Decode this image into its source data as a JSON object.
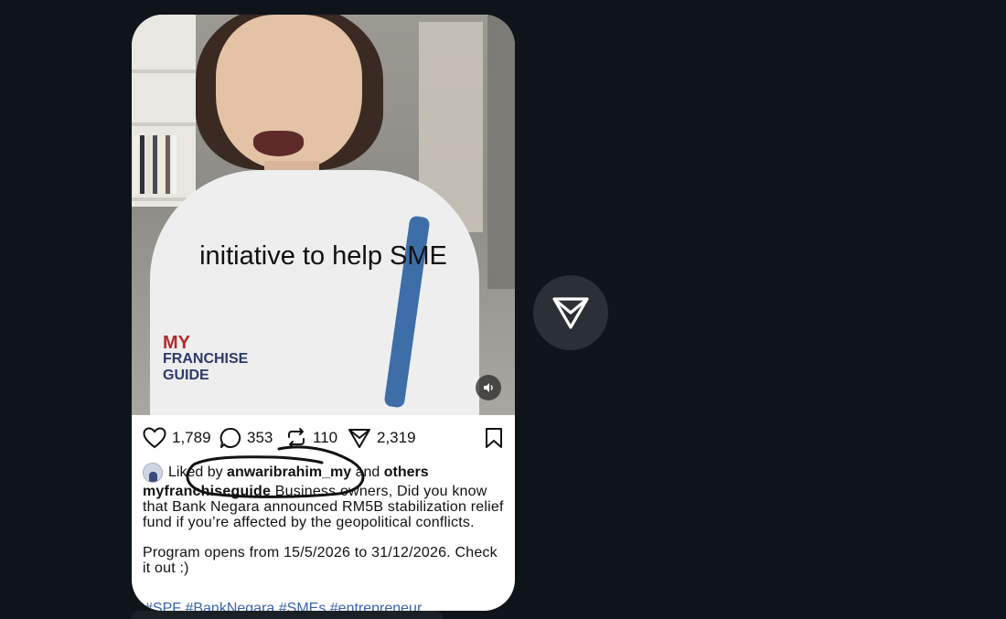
{
  "post": {
    "media": {
      "caption_overlay": "initiative to help SME",
      "shirt_logo": {
        "line1": "MY",
        "line2": "FRANCHISE",
        "line3": "GUIDE"
      }
    },
    "stats": {
      "likes": "1,789",
      "comments": "353",
      "reposts": "110",
      "shares": "2,319"
    },
    "liked_by": {
      "prefix": "Liked by",
      "user": "anwaribrahim_my",
      "connector": "and",
      "others": "others"
    },
    "caption": {
      "username": "myfranchiseguide",
      "text": "Business owners, Did you know that Bank Negara announced RM5B stabilization relief fund if you’re affected by the geopolitical conflicts.",
      "paragraph2": "Program opens from 15/5/2026 to 31/12/2026. Check it out :)",
      "hashtags": "#SPF #BankNegara #SMEs #entrepreneur"
    }
  },
  "icons": {
    "like": "heart-icon",
    "comment": "comment-icon",
    "repost": "repost-icon",
    "share": "share-icon",
    "bookmark": "bookmark-icon",
    "mute": "speaker-icon",
    "fab": "share-triangle-icon"
  },
  "colors": {
    "page_bg": "#0f141a",
    "card_bg": "#ffffff",
    "hashtag": "#3a63a8",
    "fab_bg": "#2b3036"
  }
}
